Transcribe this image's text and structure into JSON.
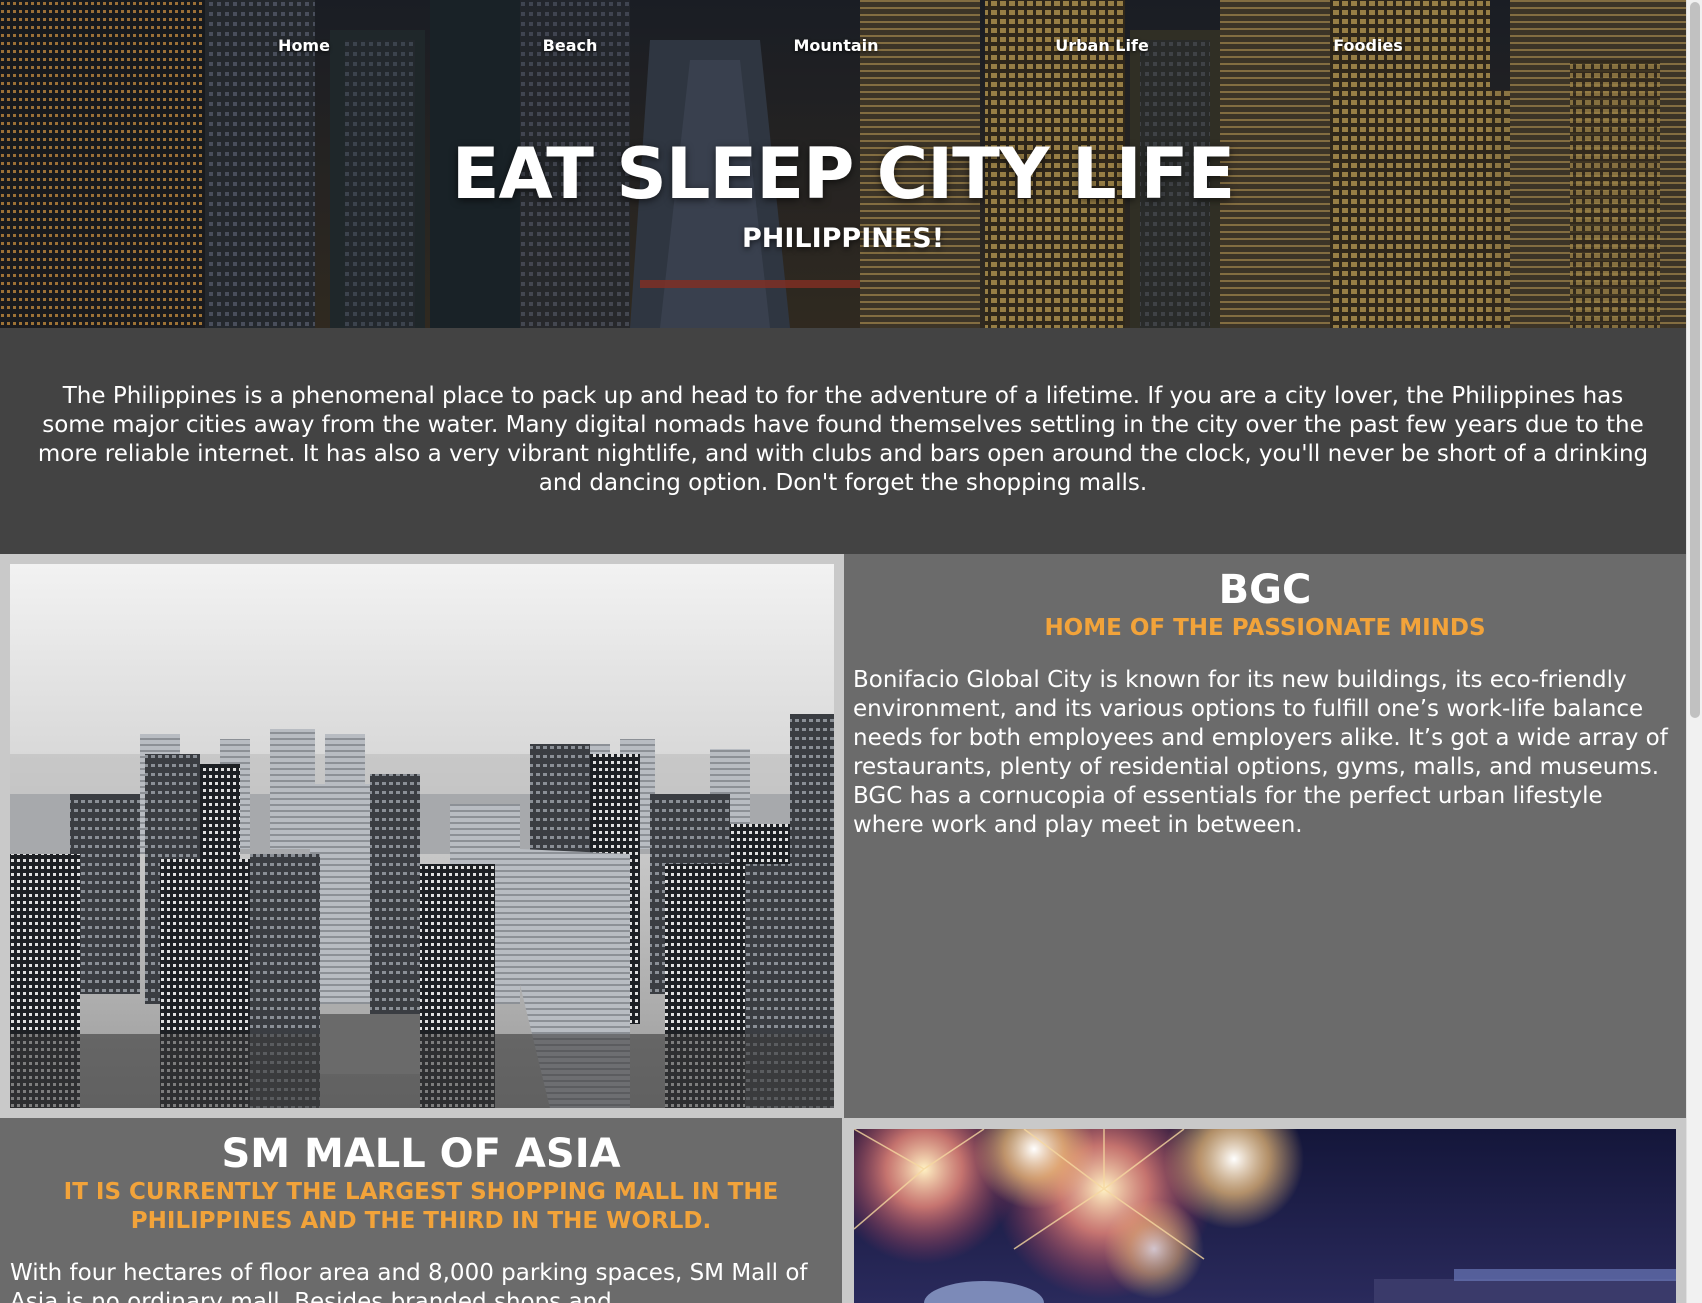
{
  "nav": {
    "items": [
      {
        "label": "Home"
      },
      {
        "label": "Beach"
      },
      {
        "label": "Mountain"
      },
      {
        "label": "Urban Life"
      },
      {
        "label": "Foodies"
      }
    ]
  },
  "hero": {
    "title": "EAT SLEEP CITY LIFE",
    "subtitle": "PHILIPPINES!"
  },
  "intro": {
    "text": "The Philippines is a phenomenal place to pack up and head to for the adventure of a lifetime. If you are a city lover, the Philippines has some major cities away from the water. Many digital nomads have found themselves settling in the city over the past few years due to the more reliable internet. It has also a very vibrant nightlife, and with clubs and bars open around the clock, you'll never be short of a drinking and dancing option. Don't forget the shopping malls."
  },
  "sections": [
    {
      "title": "BGC",
      "tagline": "HOME OF THE PASSIONATE MINDS",
      "body": "Bonifacio Global City is known for its new buildings, its eco-friendly environment, and its various options to fulfill one’s work-life balance needs for both employees and employers alike. It’s got a wide array of restaurants, plenty of residential options, gyms, malls, and museums. BGC has a cornucopia of essentials for the perfect urban lifestyle where work and play meet in between."
    },
    {
      "title": "SM MALL OF ASIA",
      "tagline": "IT IS CURRENTLY THE LARGEST SHOPPING MALL IN THE PHILIPPINES AND THE THIRD IN THE WORLD.",
      "body": "With four hectares of floor area and 8,000 parking spaces, SM Mall of Asia is no ordinary mall. Besides branded shops and"
    }
  ],
  "colors": {
    "accent": "#f2a33a",
    "intro_bg": "#434343",
    "panel_bg": "#6b6b6b",
    "gutter": "#c9c9c9"
  }
}
